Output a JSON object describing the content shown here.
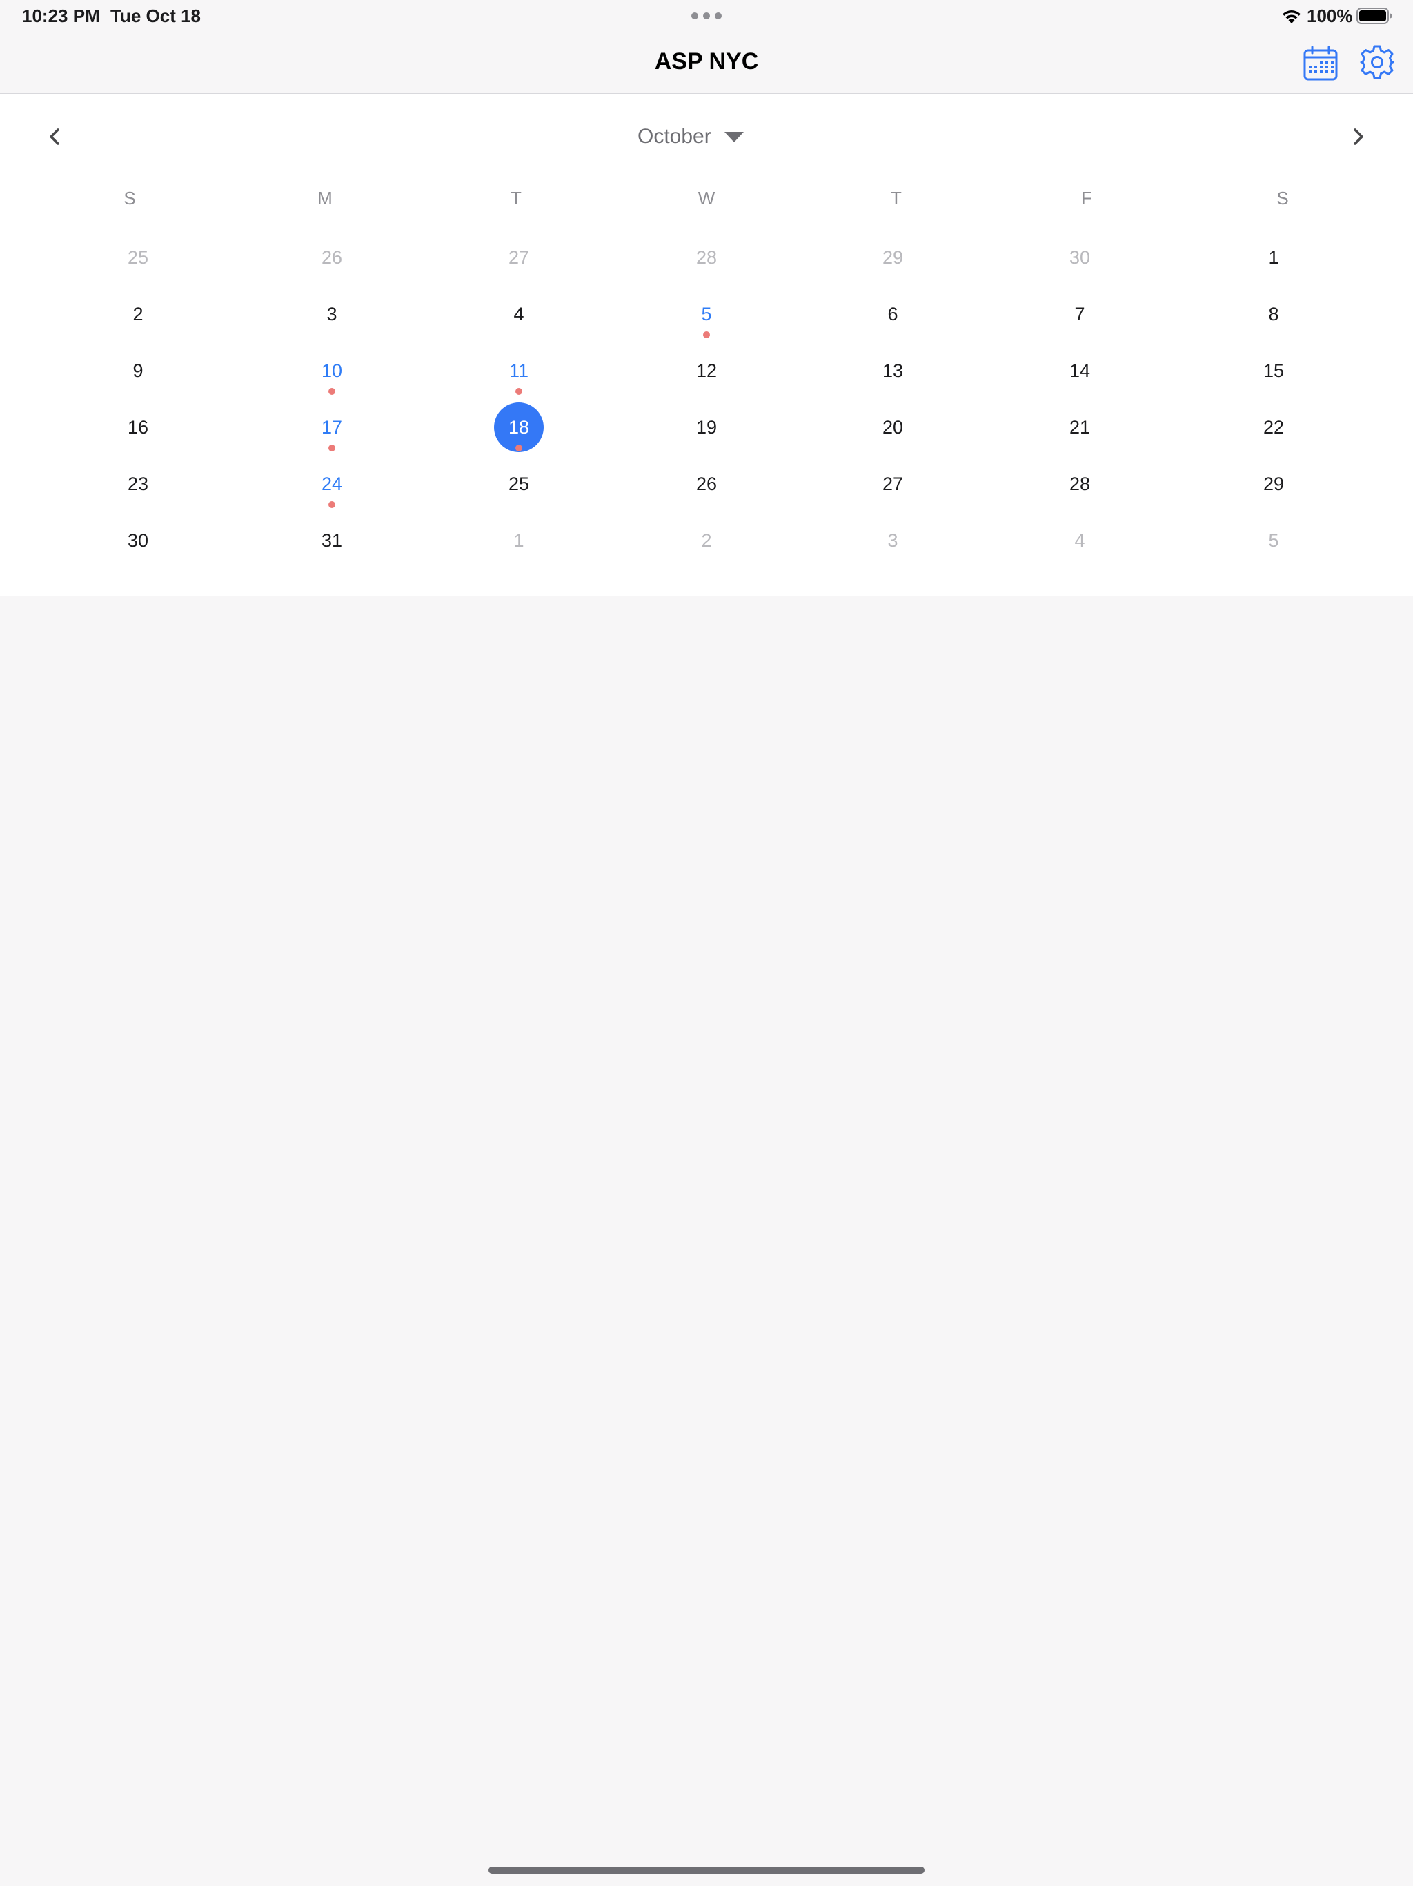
{
  "status_bar": {
    "time": "10:23 PM",
    "date": "Tue Oct 18",
    "battery": "100%",
    "icons": [
      "wifi-icon",
      "battery-icon"
    ]
  },
  "nav": {
    "title": "ASP NYC",
    "buttons": [
      "calendar-icon",
      "gear-icon"
    ]
  },
  "calendar": {
    "month": "October",
    "weekdays": [
      "S",
      "M",
      "T",
      "W",
      "T",
      "F",
      "S"
    ],
    "selected_day": "18",
    "weeks": [
      [
        {
          "d": "25",
          "outside": true
        },
        {
          "d": "26",
          "outside": true
        },
        {
          "d": "27",
          "outside": true
        },
        {
          "d": "28",
          "outside": true
        },
        {
          "d": "29",
          "outside": true
        },
        {
          "d": "30",
          "outside": true
        },
        {
          "d": "1"
        }
      ],
      [
        {
          "d": "2"
        },
        {
          "d": "3"
        },
        {
          "d": "4"
        },
        {
          "d": "5",
          "event": true
        },
        {
          "d": "6"
        },
        {
          "d": "7"
        },
        {
          "d": "8"
        }
      ],
      [
        {
          "d": "9"
        },
        {
          "d": "10",
          "event": true
        },
        {
          "d": "11",
          "event": true
        },
        {
          "d": "12"
        },
        {
          "d": "13"
        },
        {
          "d": "14"
        },
        {
          "d": "15"
        }
      ],
      [
        {
          "d": "16"
        },
        {
          "d": "17",
          "event": true
        },
        {
          "d": "18",
          "event": true,
          "selected": true
        },
        {
          "d": "19"
        },
        {
          "d": "20"
        },
        {
          "d": "21"
        },
        {
          "d": "22"
        }
      ],
      [
        {
          "d": "23"
        },
        {
          "d": "24",
          "event": true
        },
        {
          "d": "25"
        },
        {
          "d": "26"
        },
        {
          "d": "27"
        },
        {
          "d": "28"
        },
        {
          "d": "29"
        }
      ],
      [
        {
          "d": "30"
        },
        {
          "d": "31"
        },
        {
          "d": "1",
          "outside": true
        },
        {
          "d": "2",
          "outside": true
        },
        {
          "d": "3",
          "outside": true
        },
        {
          "d": "4",
          "outside": true
        },
        {
          "d": "5",
          "outside": true
        }
      ]
    ]
  },
  "colors": {
    "accent": "#3478f6",
    "event_text": "#2f7cf6",
    "event_dot": "#ec7b78",
    "outside_text": "#b9b9bd"
  }
}
